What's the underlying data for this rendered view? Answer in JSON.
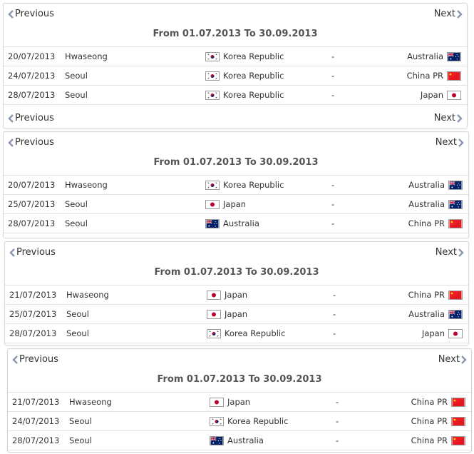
{
  "nav": {
    "previous": "Previous",
    "next": "Next"
  },
  "range_label": "From 01.07.2013 To 30.09.2013",
  "dash": "-",
  "panels": [
    {
      "matches": [
        {
          "date": "20/07/2013",
          "venue": "Hwaseong",
          "home": "Korea Republic",
          "home_flag": "kor",
          "away": "Australia",
          "away_flag": "aus"
        },
        {
          "date": "24/07/2013",
          "venue": "Seoul",
          "home": "Korea Republic",
          "home_flag": "kor",
          "away": "China PR",
          "away_flag": "chn"
        },
        {
          "date": "28/07/2013",
          "venue": "Seoul",
          "home": "Korea Republic",
          "home_flag": "kor",
          "away": "Japan",
          "away_flag": "jpn"
        }
      ]
    },
    {
      "matches": [
        {
          "date": "20/07/2013",
          "venue": "Hwaseong",
          "home": "Korea Republic",
          "home_flag": "kor",
          "away": "Australia",
          "away_flag": "aus"
        },
        {
          "date": "25/07/2013",
          "venue": "Seoul",
          "home": "Japan",
          "home_flag": "jpn",
          "away": "Australia",
          "away_flag": "aus"
        },
        {
          "date": "28/07/2013",
          "venue": "Seoul",
          "home": "Australia",
          "home_flag": "aus",
          "away": "China PR",
          "away_flag": "chn"
        }
      ]
    },
    {
      "matches": [
        {
          "date": "21/07/2013",
          "venue": "Hwaseong",
          "home": "Japan",
          "home_flag": "jpn",
          "away": "China PR",
          "away_flag": "chn"
        },
        {
          "date": "25/07/2013",
          "venue": "Seoul",
          "home": "Japan",
          "home_flag": "jpn",
          "away": "Australia",
          "away_flag": "aus"
        },
        {
          "date": "28/07/2013",
          "venue": "Seoul",
          "home": "Korea Republic",
          "home_flag": "kor",
          "away": "Japan",
          "away_flag": "jpn"
        }
      ]
    },
    {
      "matches": [
        {
          "date": "21/07/2013",
          "venue": "Hwaseong",
          "home": "Japan",
          "home_flag": "jpn",
          "away": "China PR",
          "away_flag": "chn"
        },
        {
          "date": "24/07/2013",
          "venue": "Seoul",
          "home": "Korea Republic",
          "home_flag": "kor",
          "away": "China PR",
          "away_flag": "chn"
        },
        {
          "date": "28/07/2013",
          "venue": "Seoul",
          "home": "Australia",
          "home_flag": "aus",
          "away": "China PR",
          "away_flag": "chn"
        }
      ]
    }
  ],
  "colors": {
    "chevron": "#8a96b0",
    "border": "#d8d8d8",
    "row_line": "#e2e2e2"
  }
}
